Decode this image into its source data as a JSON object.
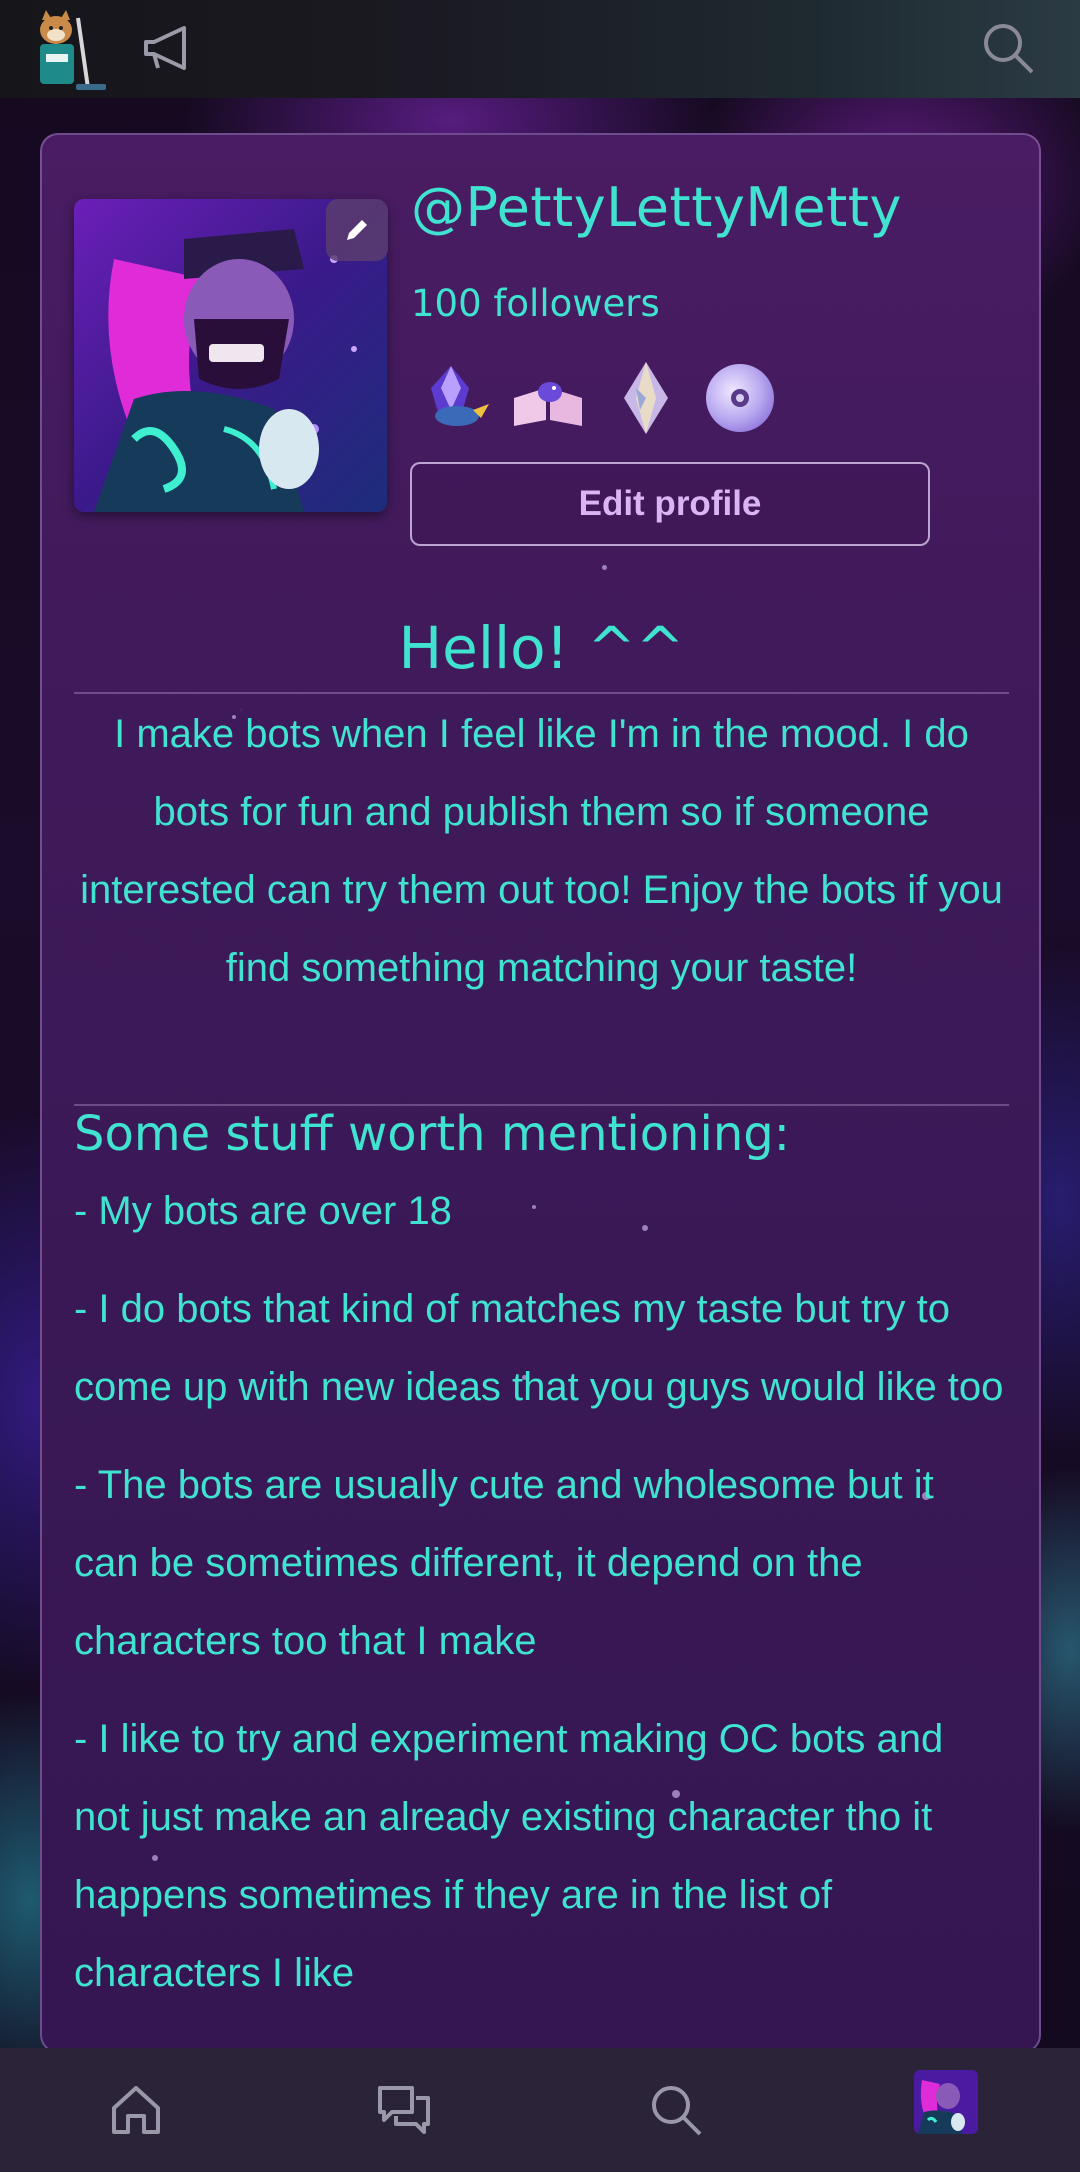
{
  "profile": {
    "username": "@PettyLettyMetty",
    "followers": "100 followers",
    "edit_profile_label": "Edit profile"
  },
  "bio": {
    "greeting": "Hello! ^^",
    "intro": "I make bots when I feel like I'm in the mood. I do bots for fun and publish them so if someone interested can try them out too! Enjoy the bots if you find something matching your taste!",
    "section_heading": "Some stuff worth mentioning:",
    "bullets": [
      "- My bots are over 18",
      "- I do bots that kind of matches my taste but try to come up with new ideas that you guys would like too",
      "- The bots are usually cute and wholesome but it can be sometimes different, it depend on the characters too that I make",
      "- I like to try and experiment making OC bots and not just make an already existing character tho it happens sometimes if they are in the list of characters I like"
    ]
  },
  "badges": [
    "crystal-bird-icon",
    "book-bird-icon",
    "gem-icon",
    "disc-icon"
  ],
  "top_bar": {
    "icons": [
      "app-logo",
      "megaphone-icon",
      "search-icon"
    ]
  },
  "bottom_nav": {
    "items": [
      "home-icon",
      "chat-icon",
      "search-icon",
      "profile-avatar"
    ]
  },
  "colors": {
    "accent_text": "#3fe3d0",
    "card_bg": "#3f1a5a",
    "button_text": "#d9b6f2",
    "nav_bg": "#2b2338"
  }
}
